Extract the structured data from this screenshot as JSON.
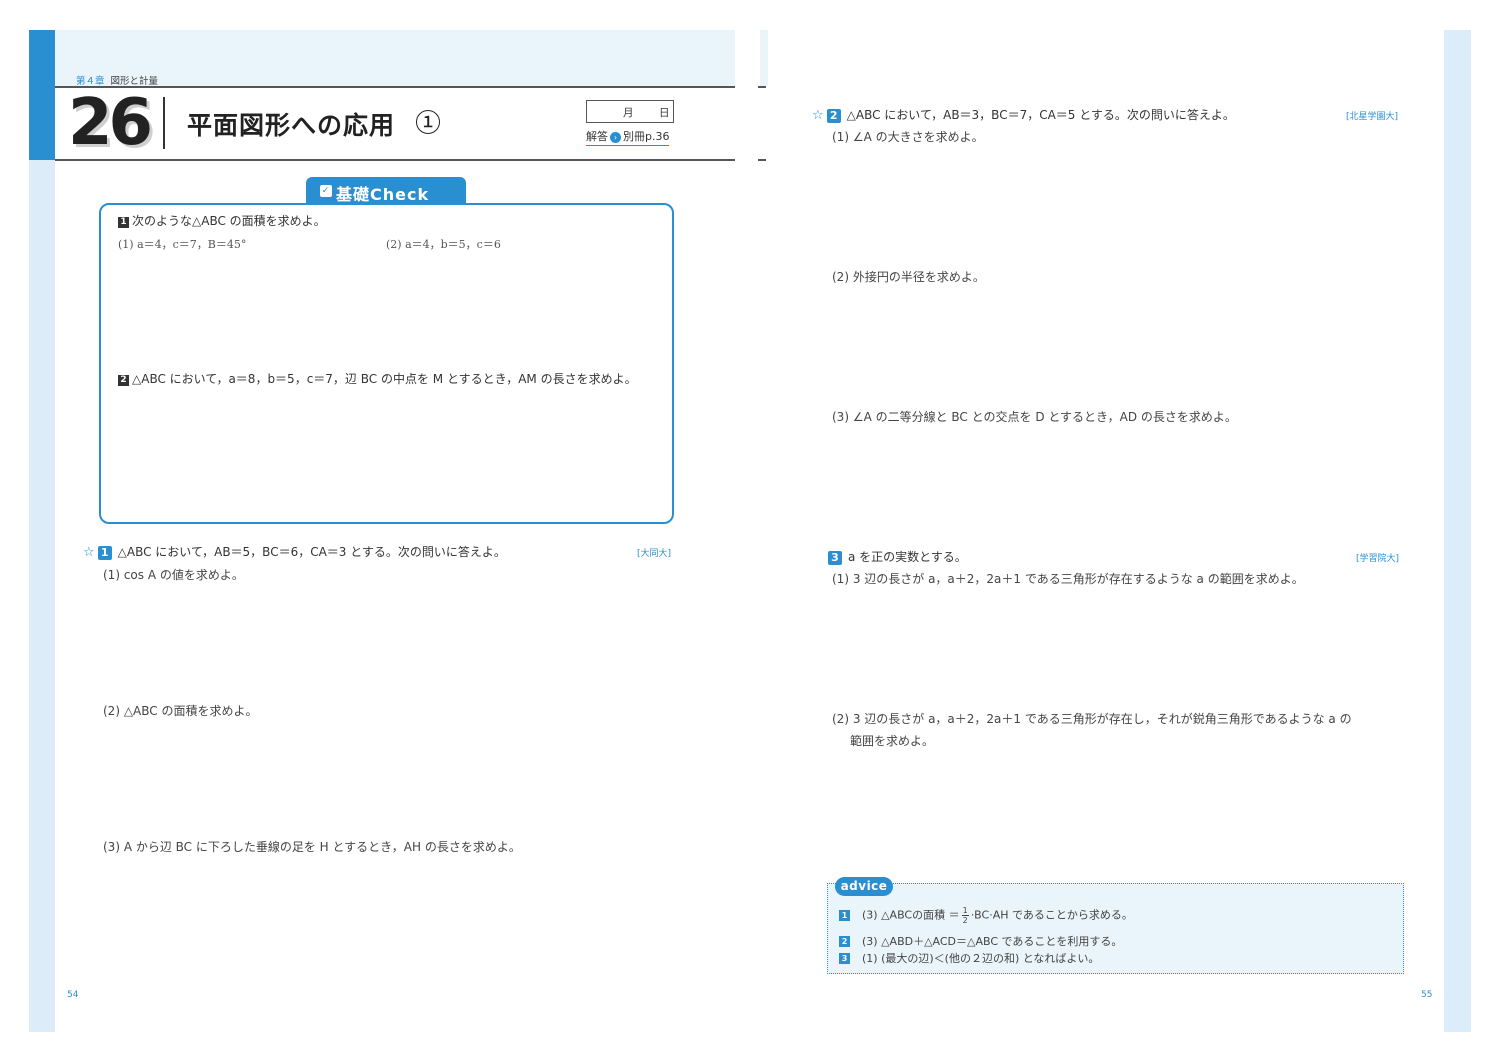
{
  "header": {
    "chapter": "第４章",
    "chapter_title": "図形と計量",
    "lesson_number": "26",
    "lesson_title": "平面図形への応用",
    "lesson_part": "１",
    "date_month": "月",
    "date_day": "日",
    "answer_label": "解答",
    "answer_arrow": "›",
    "answer_page": "別冊p.36"
  },
  "basic_check": {
    "tab_label": "基礎Check",
    "check_mark": "✓",
    "q1": {
      "num": "1",
      "text": "次のような△ABC の面積を求めよ。",
      "part1": "(1) a＝4，c＝7，B＝45°",
      "part2": "(2) a＝4，b＝5，c＝6"
    },
    "q2": {
      "num": "2",
      "text": "△ABC において，a＝8，b＝5，c＝7，辺 BC の中点を M とするとき，AM の長さを求めよ。"
    }
  },
  "problems": {
    "p1": {
      "star": "☆",
      "num": "1",
      "text": "△ABC において，AB＝5，BC＝6，CA＝3 とする。次の問いに答えよ。",
      "source": "[大同大]",
      "sub1": "(1) cos A の値を求めよ。",
      "sub2": "(2) △ABC の面積を求めよ。",
      "sub3": "(3) A から辺 BC に下ろした垂線の足を H とするとき，AH の長さを求めよ。"
    },
    "p2": {
      "star": "☆",
      "num": "2",
      "text": "△ABC において，AB＝3，BC＝7，CA＝5 とする。次の問いに答えよ。",
      "source": "[北星学園大]",
      "sub1": "(1) ∠A の大きさを求めよ。",
      "sub2": "(2) 外接円の半径を求めよ。",
      "sub3": "(3) ∠A の二等分線と BC との交点を D とするとき，AD の長さを求めよ。"
    },
    "p3": {
      "num": "3",
      "text": "a を正の実数とする。",
      "source": "[学習院大]",
      "sub1": "(1) 3 辺の長さが a，a＋2，2a＋1 である三角形が存在するような a の範囲を求めよ。",
      "sub2_line1": "(2) 3 辺の長さが a，a＋2，2a＋1 である三角形が存在し，それが鋭角三角形であるような a の",
      "sub2_line2": "範囲を求めよ。"
    }
  },
  "advice": {
    "badge": "advice",
    "items": [
      {
        "num": "1",
        "pre": "(3) △ABCの面積 ＝",
        "frac_num": "1",
        "frac_den": "2",
        "post": "·BC·AH であることから求める。"
      },
      {
        "num": "2",
        "text": "(3) △ABD＋△ACD＝△ABC であることを利用する。"
      },
      {
        "num": "3",
        "text": "(1) (最大の辺)＜(他の２辺の和) となればよい。"
      }
    ]
  },
  "page_numbers": {
    "left": "54",
    "right": "55"
  }
}
